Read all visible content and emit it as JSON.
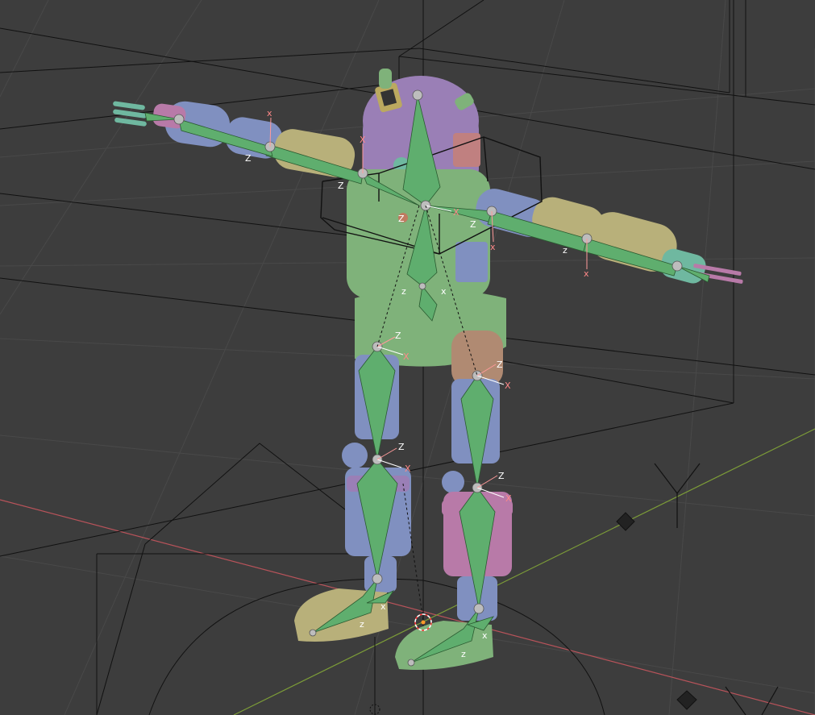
{
  "viewport": {
    "background": "#3d3d3d",
    "grid_color": "#4a4a4a",
    "x_axis_color": "#c0565a",
    "y_axis_color": "#7a9a3a"
  },
  "armature": {
    "bone_color": "#5fae6e",
    "joint_color": "#bdbdbd",
    "axis_label_x": "x",
    "axis_label_z": "z",
    "axis_label_X": "X",
    "axis_label_Z": "Z"
  },
  "mesh_colors": {
    "purple": "#9b7fb8",
    "green": "#7fb27a",
    "blue": "#8090c0",
    "yellow": "#b8b07a",
    "pink": "#b87aa8",
    "tan": "#b08a72",
    "teal": "#6fb8a0"
  },
  "gizmos": {
    "cursor_icon": "3d-cursor-icon",
    "empty_icon": "empty-diamond-icon",
    "origin_icon": "origin-dot-icon"
  }
}
